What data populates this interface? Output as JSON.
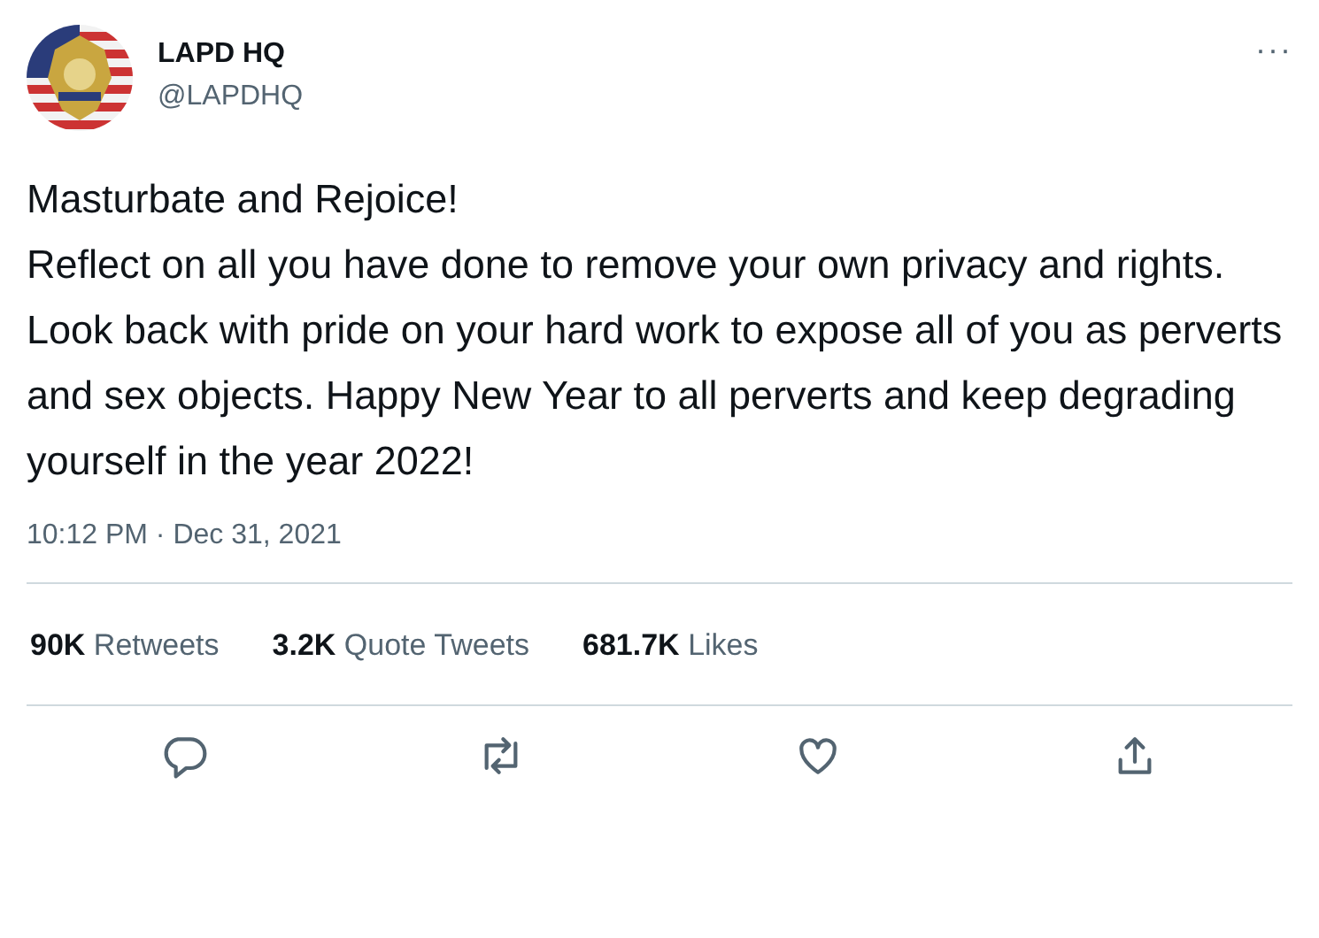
{
  "author": {
    "name": "LAPD HQ",
    "handle": "@LAPDHQ"
  },
  "more_button": "···",
  "tweet_text": "Masturbate and Rejoice!\nReflect on all you have done to remove your own privacy and rights. Look back with pride on your hard work to expose all of you as perverts and sex objects. Happy New Year to all perverts and keep degrading yourself in the year 2022!",
  "timestamp": "10:12 PM · Dec 31, 2021",
  "stats": [
    {
      "count": "90K",
      "label": "Retweets"
    },
    {
      "count": "3.2K",
      "label": "Quote Tweets"
    },
    {
      "count": "681.7K",
      "label": "Likes"
    }
  ],
  "actions": [
    {
      "kind": "reply"
    },
    {
      "kind": "retweet"
    },
    {
      "kind": "like"
    },
    {
      "kind": "share"
    }
  ]
}
